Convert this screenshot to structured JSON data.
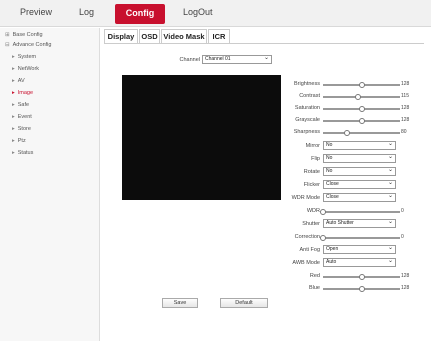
{
  "nav": {
    "preview": "Preview",
    "log": "Log",
    "config": "Config",
    "logout": "LogOut"
  },
  "sidebar": {
    "base_config": "Base Config",
    "advance_config": "Advance Config",
    "items": [
      "System",
      "NetWork",
      "AV",
      "Image",
      "Safe",
      "Event",
      "Store",
      "Ptz",
      "Status"
    ],
    "active": "Image"
  },
  "tabs": [
    "Display",
    "OSD",
    "Video Mask",
    "ICR"
  ],
  "channel": {
    "label": "Channel",
    "value": "Channel 01"
  },
  "sliders": [
    {
      "label": "Brightness",
      "value": 128,
      "level": 0.5
    },
    {
      "label": "Contrast",
      "value": 115,
      "level": 0.45
    },
    {
      "label": "Saturation",
      "value": 128,
      "level": 0.5
    },
    {
      "label": "Grayscale",
      "value": 128,
      "level": 0.5
    },
    {
      "label": "Sharpness",
      "value": 80,
      "level": 0.31
    }
  ],
  "selects": [
    {
      "label": "Mirror",
      "value": "No"
    },
    {
      "label": "Flip",
      "value": "No"
    },
    {
      "label": "Rotate",
      "value": "No"
    },
    {
      "label": "Flicker",
      "value": "Close"
    },
    {
      "label": "WDR Mode",
      "value": "Close"
    }
  ],
  "wdr": {
    "label": "WDR",
    "value": 0,
    "level": 0.0
  },
  "shutter": {
    "label": "Shutter",
    "value": "Auto Shutter"
  },
  "correction": {
    "label": "Correction",
    "value": 0,
    "level": 0.0
  },
  "anti_fog": {
    "label": "Anti Fog",
    "value": "Open"
  },
  "awb_mode": {
    "label": "AWB Mode",
    "value": "Auto"
  },
  "red": {
    "label": "Red",
    "value": 128,
    "level": 0.5
  },
  "blue": {
    "label": "Blue",
    "value": 128,
    "level": 0.5
  },
  "buttons": {
    "save": "Save",
    "default": "Default"
  }
}
